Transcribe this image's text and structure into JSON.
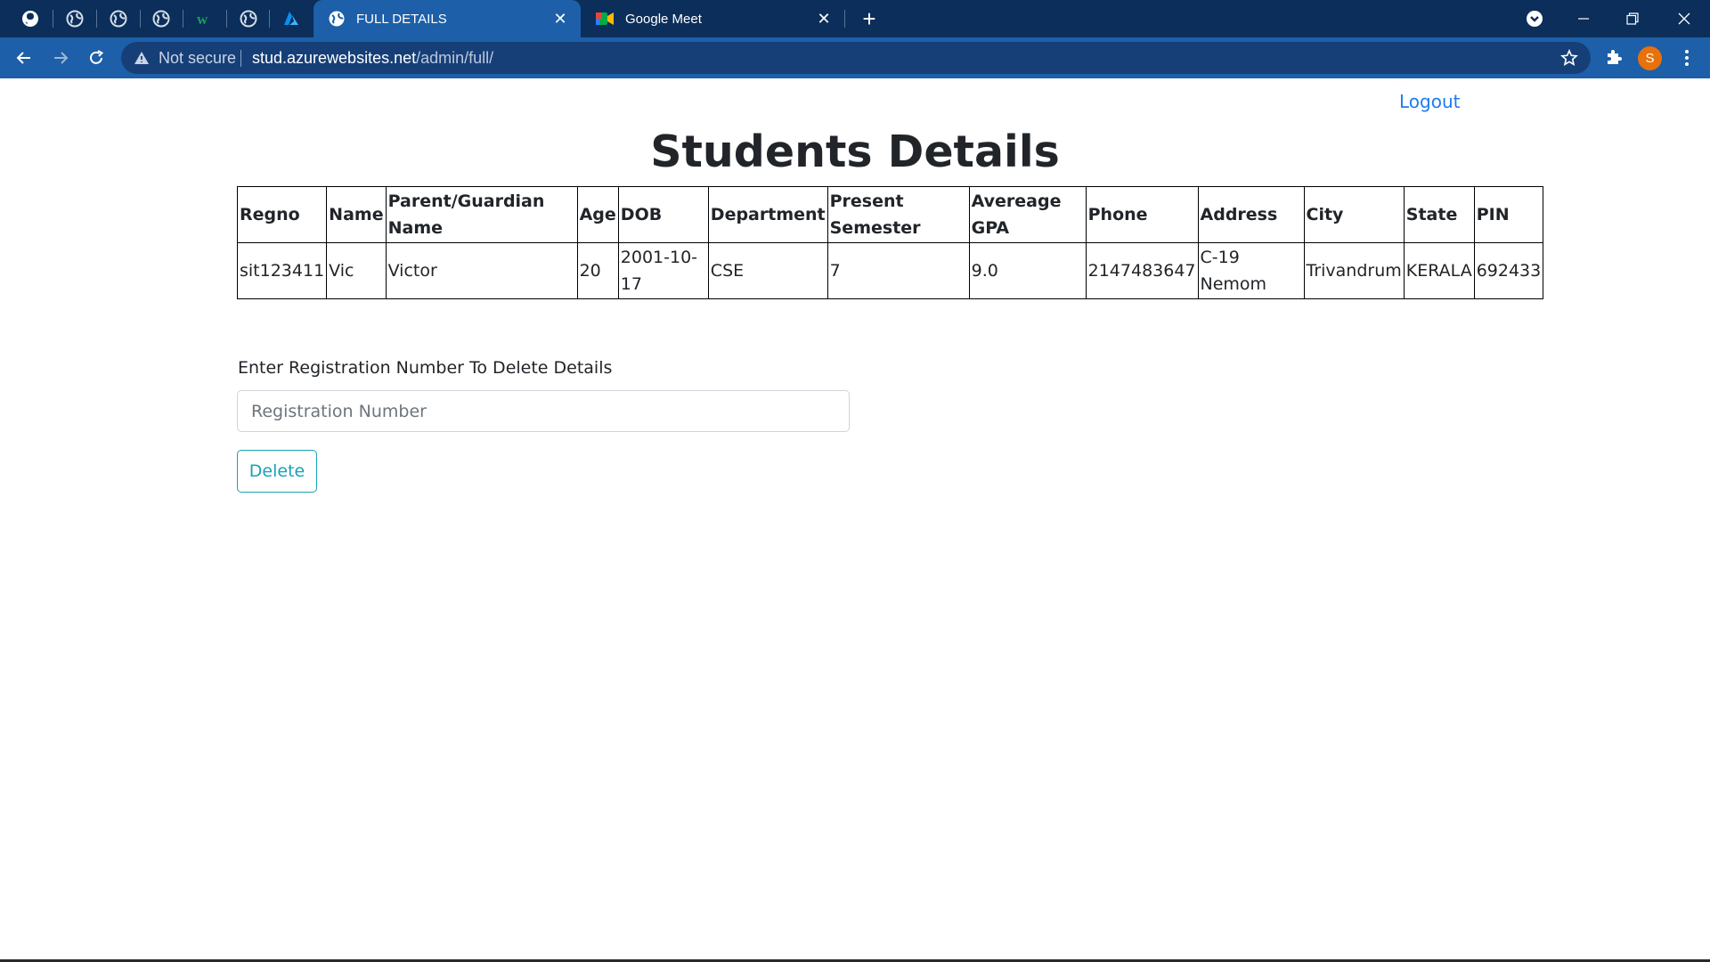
{
  "browser": {
    "tabs": [
      {
        "title": "FULL DETAILS",
        "icon": "globe-icon",
        "active": true
      },
      {
        "title": "Google Meet",
        "icon": "google-meet-icon",
        "active": false
      }
    ],
    "pinned_tabs": [
      "github-icon",
      "globe-icon",
      "globe-icon",
      "globe-icon",
      "w-site-icon",
      "globe-icon",
      "azure-icon"
    ],
    "omnibox": {
      "security_label": "Not secure",
      "url_host": "stud.azurewebsites.net",
      "url_path": "/admin/full/"
    },
    "profile_initial": "S"
  },
  "page": {
    "logout_label": "Logout",
    "title": "Students Details",
    "table": {
      "headers": [
        "Regno",
        "Name",
        "Parent/Guardian Name",
        "Age",
        "DOB",
        "Department",
        "Present Semester",
        "Avereage GPA",
        "Phone",
        "Address",
        "City",
        "State",
        "PIN"
      ],
      "rows": [
        [
          "sit123411",
          "Vic",
          "Victor",
          "20",
          "2001-10-17",
          "CSE",
          "7",
          "9.0",
          "2147483647",
          "C-19 Nemom",
          "Trivandrum",
          "KERALA",
          "692433"
        ]
      ]
    },
    "delete_form": {
      "label": "Enter Registration Number To Delete Details",
      "placeholder": "Registration Number",
      "value": "",
      "button_label": "Delete"
    }
  },
  "colors": {
    "tabbar_bg": "#0b2e5a",
    "toolbar_bg": "#1d5fa8",
    "link": "#1d7cf2",
    "info_button": "#17a2b8"
  }
}
